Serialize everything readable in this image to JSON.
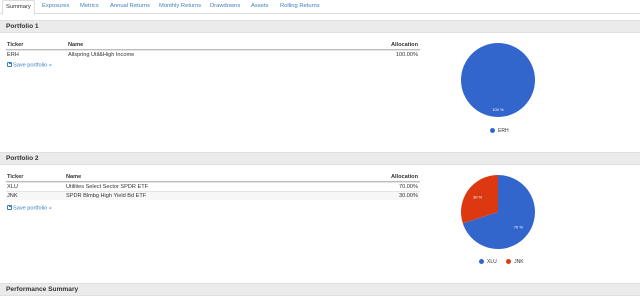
{
  "tabs": [
    {
      "label": "Summary"
    },
    {
      "label": "Exposures"
    },
    {
      "label": "Metrics"
    },
    {
      "label": "Annual Returns"
    },
    {
      "label": "Monthly Returns"
    },
    {
      "label": "Drawdowns"
    },
    {
      "label": "Assets"
    },
    {
      "label": "Rolling Returns"
    }
  ],
  "portfolio1": {
    "title": "Portfolio 1",
    "columns": {
      "ticker": "Ticker",
      "name": "Name",
      "allocation": "Allocation"
    },
    "rows": [
      {
        "ticker": "ERH",
        "name": "Allspring Util&High Income",
        "allocation": "100.00%"
      }
    ],
    "save_label": "Save portfolio »",
    "chart": {
      "slices": [
        {
          "label": "ERH",
          "value": 100,
          "text": "100 %",
          "color": "#3366cc"
        }
      ]
    }
  },
  "portfolio2": {
    "title": "Portfolio 2",
    "columns": {
      "ticker": "Ticker",
      "name": "Name",
      "allocation": "Allocation"
    },
    "rows": [
      {
        "ticker": "XLU",
        "name": "Utilities Select Sector SPDR ETF",
        "allocation": "70.00%"
      },
      {
        "ticker": "JNK",
        "name": "SPDR Blmbg High Yield Bd ETF",
        "allocation": "30.00%"
      }
    ],
    "save_label": "Save portfolio »",
    "chart": {
      "slices": [
        {
          "label": "XLU",
          "value": 70,
          "text": "70 %",
          "color": "#3366cc"
        },
        {
          "label": "JNK",
          "value": 30,
          "text": "30 %",
          "color": "#dc3912"
        }
      ]
    }
  },
  "performance": {
    "title": "Performance Summary"
  }
}
